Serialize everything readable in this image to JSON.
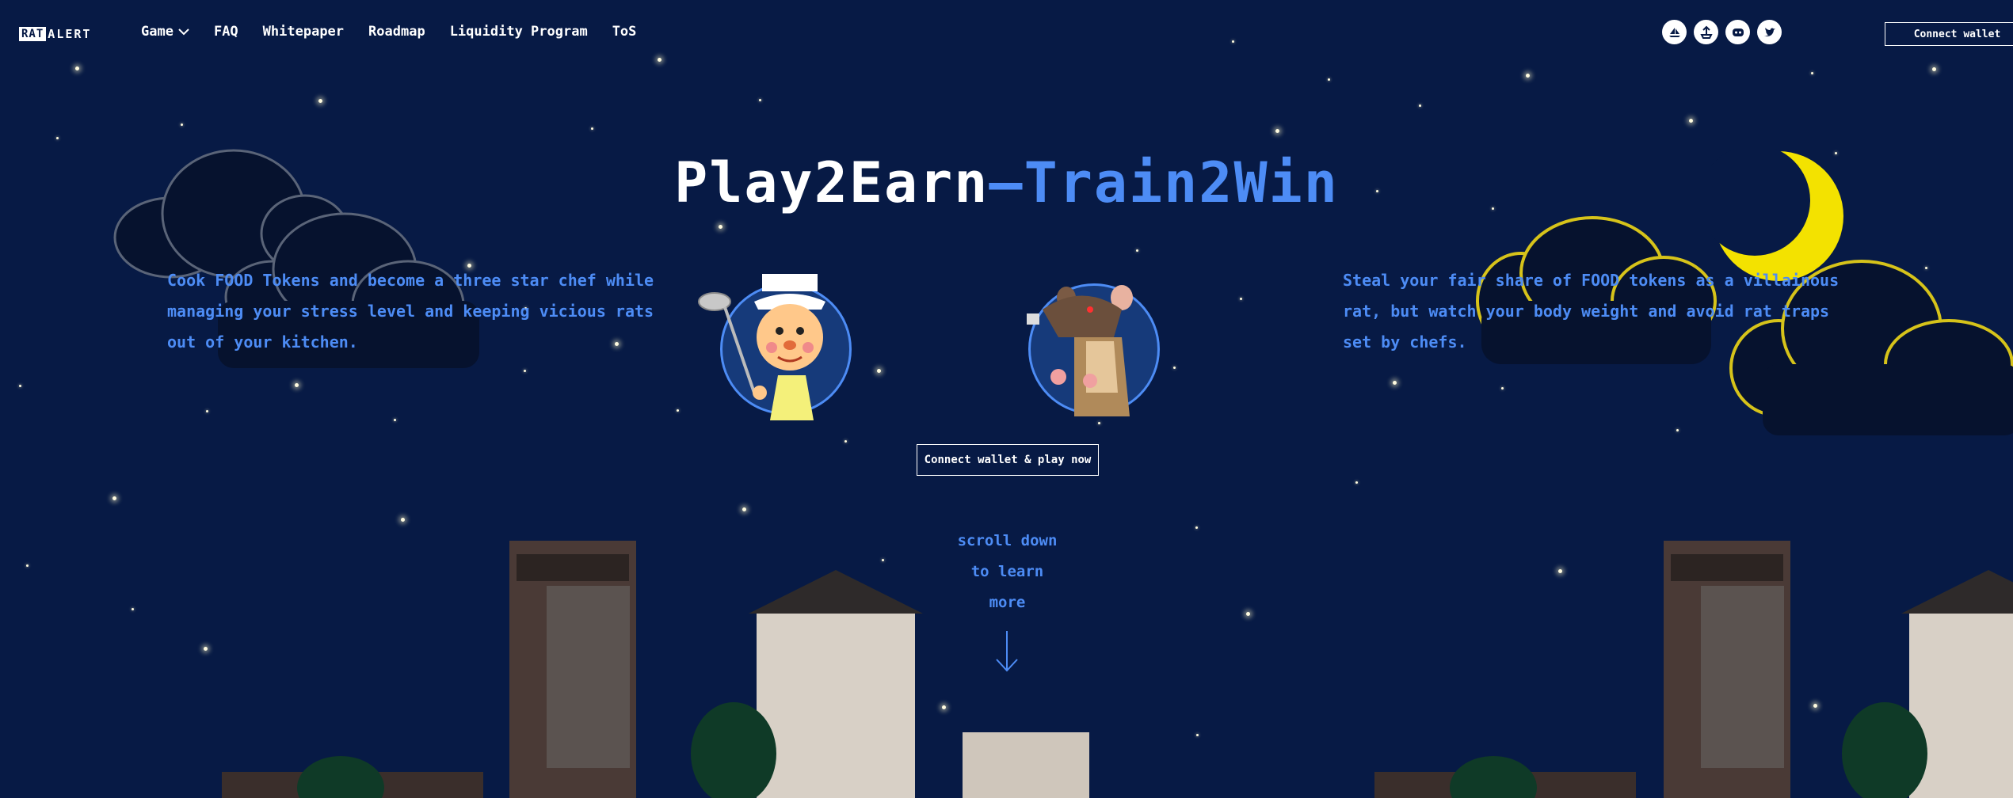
{
  "nav": {
    "logo_box": "RAT",
    "logo_text": "ALERT",
    "items": [
      "Game",
      "FAQ",
      "Whitepaper",
      "Roadmap",
      "Liquidity Program",
      "ToS"
    ],
    "connect_label": "Connect wallet"
  },
  "socials": [
    {
      "icon": "opensea-icon"
    },
    {
      "icon": "ship-icon"
    },
    {
      "icon": "discord-icon"
    },
    {
      "icon": "twitter-icon"
    }
  ],
  "hero": {
    "title_white": "Play2Earn",
    "title_dash": "—",
    "title_blue": "Train2Win",
    "desc_left": "Cook FOOD Tokens and become a three star chef while managing your stress level and keeping vicious rats out of your kitchen.",
    "desc_right": "Steal your fair share of FOOD tokens as a villainous rat, but watch your body weight and avoid rat traps set by chefs.",
    "cta": "Connect wallet & play now",
    "scroll_line1": "scroll down",
    "scroll_line2": "to learn",
    "scroll_line3": "more"
  },
  "colors": {
    "background": "#071a45",
    "accent_blue": "#4d8cf5",
    "moon": "#f3e200"
  }
}
